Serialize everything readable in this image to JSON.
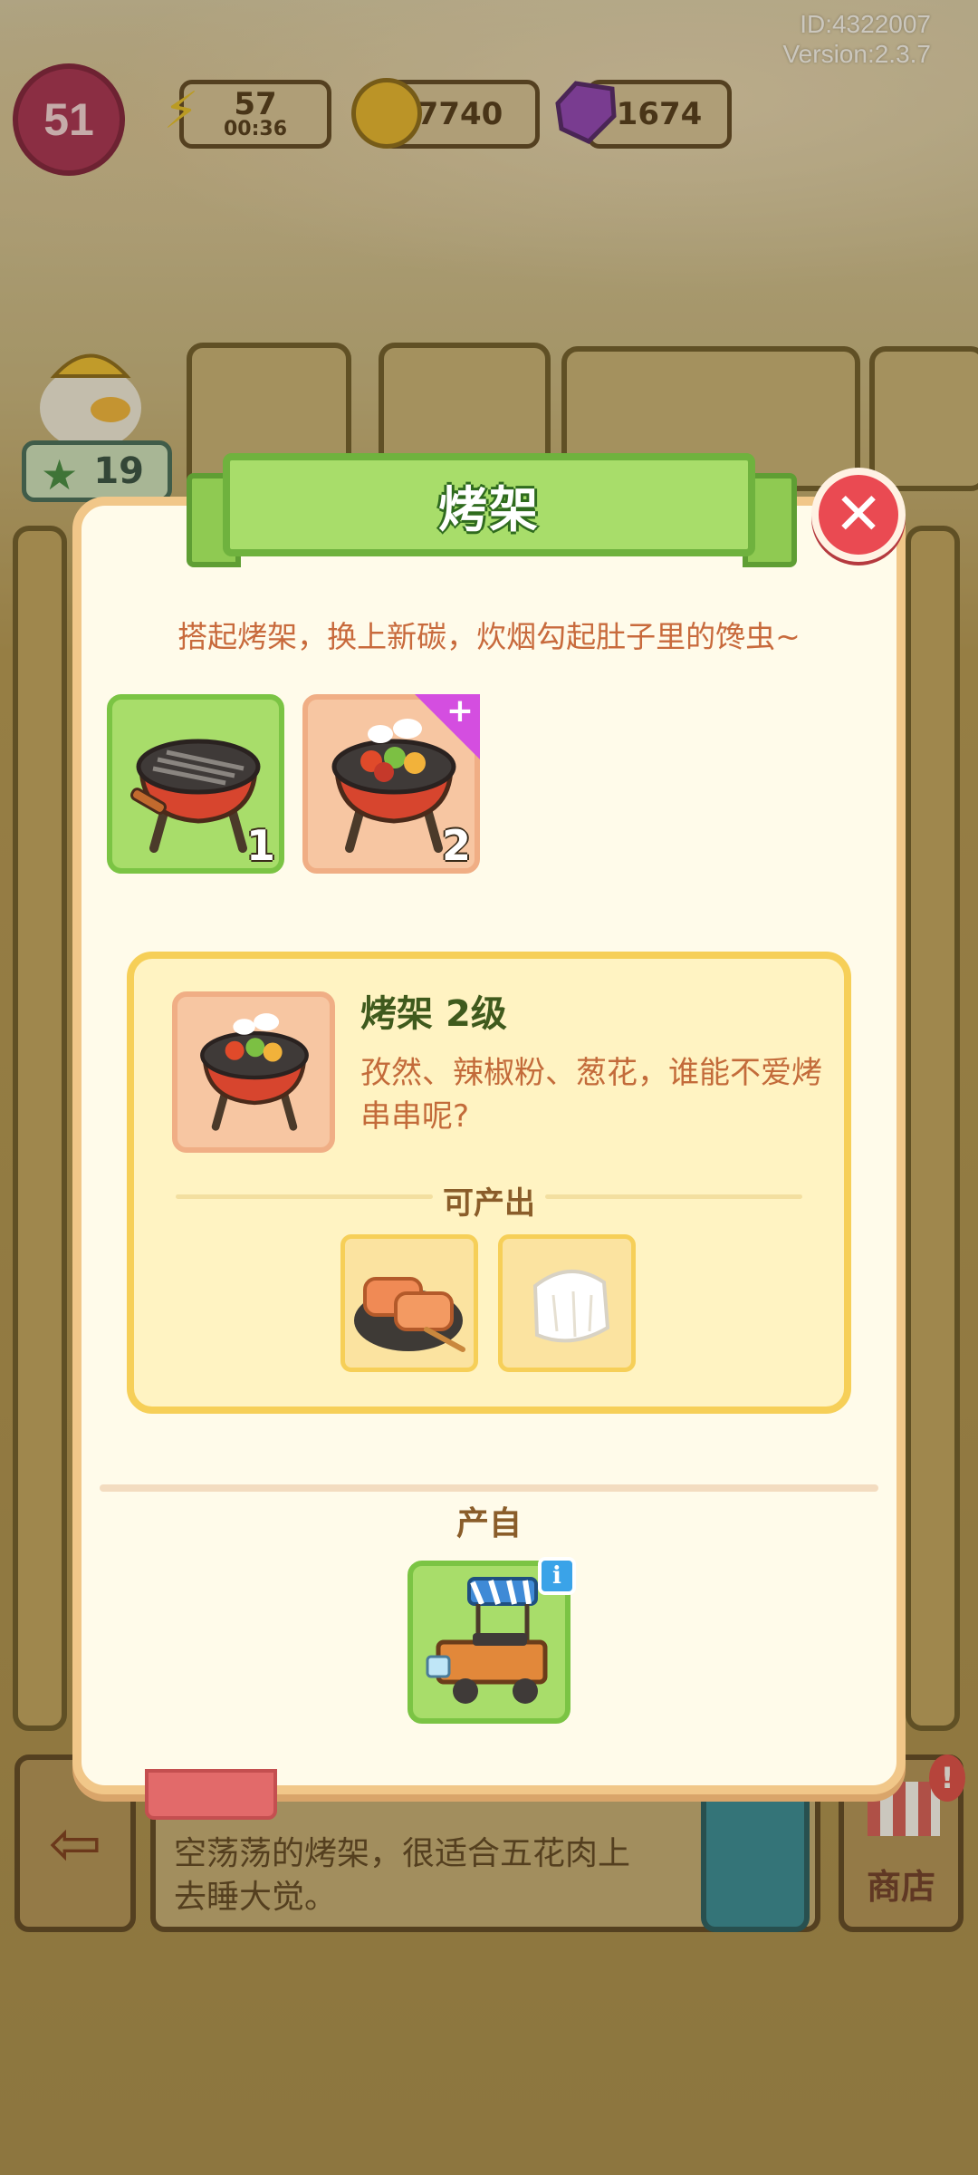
{
  "hud": {
    "id_text": "ID:4322007",
    "version_text": "Version:2.3.7",
    "level": "51",
    "energy": "57",
    "energy_timer": "00:36",
    "coins": "7740",
    "gems": "1674",
    "stars": "19"
  },
  "background": {
    "bottom_description_line1": "空荡荡的烤架，很适合五花肉上",
    "bottom_description_line2": "去睡大觉。",
    "shop_label": "商店"
  },
  "modal": {
    "title": "烤架",
    "description": "搭起烤架，换上新碳，炊烟勾起肚子里的馋虫~",
    "tiers": [
      {
        "number": "1",
        "icon": "empty-grill"
      },
      {
        "number": "2",
        "icon": "loaded-grill"
      }
    ],
    "selected": {
      "name": "烤架",
      "level_text": "2级",
      "text": "孜然、辣椒粉、葱花，谁能不爱烤串串呢?"
    },
    "produces_label": "可产出",
    "produces": [
      {
        "icon": "grilled-skewers"
      },
      {
        "icon": "cloth-bun"
      }
    ],
    "source_label": "产自",
    "source_icon": "bbq-food-cart"
  }
}
